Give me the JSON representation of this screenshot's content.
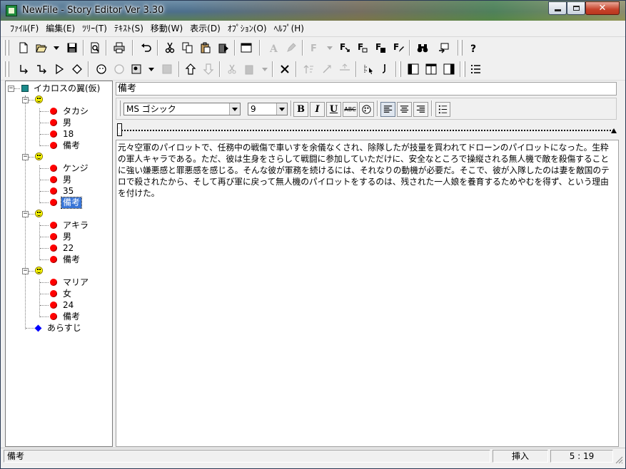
{
  "window": {
    "title": "NewFile - Story Editor Ver 3.30"
  },
  "menu": [
    "ﾌｧｲﾙ(F)",
    "編集(E)",
    "ﾂﾘｰ(T)",
    "ﾃｷｽﾄ(S)",
    "移動(W)",
    "表示(D)",
    "ｵﾌﾟｼｮﾝ(O)",
    "ﾍﾙﾌﾟ(H)"
  ],
  "tree": {
    "root": "イカロスの翼(仮)",
    "groups": [
      {
        "items": [
          "タカシ",
          "男",
          "18",
          "備考"
        ]
      },
      {
        "items": [
          "ケンジ",
          "男",
          "35",
          "備考"
        ]
      },
      {
        "items": [
          "アキラ",
          "男",
          "22",
          "備考"
        ]
      },
      {
        "items": [
          "マリア",
          "女",
          "24",
          "備考"
        ]
      }
    ],
    "summary": "あらすじ",
    "selected": "備考"
  },
  "editor": {
    "title": "備考",
    "font": "MS ゴシック",
    "size": "9",
    "text": "元々空軍のパイロットで、任務中の戦傷で車いすを余儀なくされ、除隊したが技量を買われてドローンのパイロットになった。生粋の軍人キャラである。ただ、彼は生身をさらして戦闘に参加していただけに、安全なところで操縦される無人機で敵を殺傷することに強い嫌悪感と罪悪感を感じる。そんな彼が軍務を続けるには、それなりの動機が必要だ。そこで、彼が入隊したのは妻を敵国のテロで殺されたから、そして再び軍に戻って無人機のパイロットをするのは、残された一人娘を養育するためやむを得ず、という理由を付けた。",
    "format_buttons": {
      "bold": "B",
      "italic": "I",
      "underline": "U",
      "strike": "ABC"
    }
  },
  "status": {
    "node": "備考",
    "mode": "挿入",
    "position": "5 :  19"
  },
  "colors": {
    "node_dot": "#ff0000",
    "root_square": "#1a8a8a",
    "summary_diamond": "#0000ff",
    "selection": "#3875d7",
    "group_smiley": "#ffff00"
  }
}
